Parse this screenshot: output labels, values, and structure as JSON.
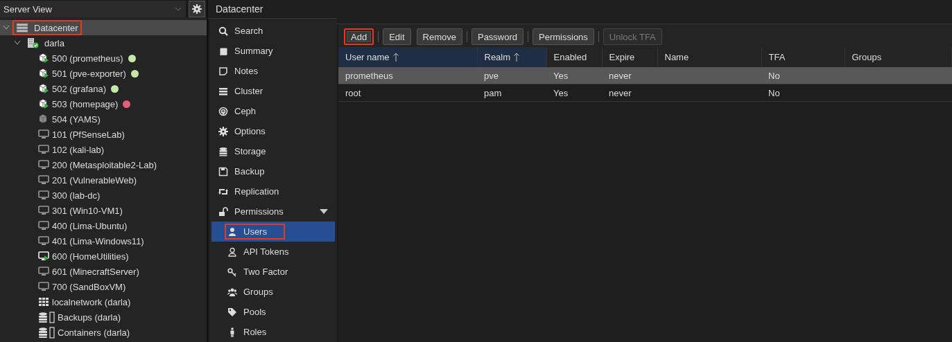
{
  "view_selector": {
    "value": "Server View"
  },
  "tree": [
    {
      "label": "Datacenter",
      "kind": "datacenter",
      "selected": true,
      "highlighted": true,
      "expanded": true,
      "children": [
        {
          "label": "darla",
          "kind": "node",
          "selected": false,
          "highlighted": false,
          "expanded": true,
          "children": [
            {
              "label": "500 (prometheus)",
              "kind": "container",
              "running": true,
              "color": "#c5e8a8",
              "selected": false,
              "highlighted": false
            },
            {
              "label": "501 (pve-exporter)",
              "kind": "container",
              "running": true,
              "color": "#c5e8a8",
              "selected": false,
              "highlighted": false
            },
            {
              "label": "502 (grafana)",
              "kind": "container",
              "running": true,
              "color": "#c5e8a8",
              "selected": false,
              "highlighted": false
            },
            {
              "label": "503 (homepage)",
              "kind": "container",
              "running": true,
              "color": "#e85b7e",
              "selected": false,
              "highlighted": false
            },
            {
              "label": "504 (YAMS)",
              "kind": "container",
              "running": false,
              "selected": false,
              "highlighted": false
            },
            {
              "label": "101 (PfSenseLab)",
              "kind": "vm",
              "running": false,
              "selected": false,
              "highlighted": false
            },
            {
              "label": "102 (kali-lab)",
              "kind": "vm",
              "running": false,
              "selected": false,
              "highlighted": false
            },
            {
              "label": "200 (Metasploitable2-Lab)",
              "kind": "vm",
              "running": false,
              "selected": false,
              "highlighted": false
            },
            {
              "label": "201 (VulnerableWeb)",
              "kind": "vm",
              "running": false,
              "selected": false,
              "highlighted": false
            },
            {
              "label": "300 (lab-dc)",
              "kind": "vm",
              "running": false,
              "selected": false,
              "highlighted": false
            },
            {
              "label": "301 (Win10-VM1)",
              "kind": "vm",
              "running": false,
              "selected": false,
              "highlighted": false
            },
            {
              "label": "400 (Lima-Ubuntu)",
              "kind": "vm",
              "running": false,
              "selected": false,
              "highlighted": false
            },
            {
              "label": "401 (Lima-Windows11)",
              "kind": "vm",
              "running": false,
              "selected": false,
              "highlighted": false
            },
            {
              "label": "600 (HomeUtilities)",
              "kind": "vm",
              "running": true,
              "selected": false,
              "highlighted": false
            },
            {
              "label": "601 (MinecraftServer)",
              "kind": "vm",
              "running": false,
              "selected": false,
              "highlighted": false
            },
            {
              "label": "700 (SandBoxVM)",
              "kind": "vm",
              "running": false,
              "selected": false,
              "highlighted": false
            },
            {
              "label": "localnetwork (darla)",
              "kind": "network",
              "selected": false,
              "highlighted": false
            },
            {
              "label": "Backups (darla)",
              "kind": "storage",
              "selected": false,
              "highlighted": false
            },
            {
              "label": "Containers (darla)",
              "kind": "storage",
              "selected": false,
              "highlighted": false
            }
          ]
        }
      ]
    }
  ],
  "panel_title": "Datacenter",
  "nav": [
    {
      "label": "Search",
      "selected": false,
      "highlighted": false
    },
    {
      "label": "Summary",
      "selected": false,
      "highlighted": false
    },
    {
      "label": "Notes",
      "selected": false,
      "highlighted": false
    },
    {
      "label": "Cluster",
      "selected": false,
      "highlighted": false
    },
    {
      "label": "Ceph",
      "selected": false,
      "highlighted": false
    },
    {
      "label": "Options",
      "selected": false,
      "highlighted": false
    },
    {
      "label": "Storage",
      "selected": false,
      "highlighted": false
    },
    {
      "label": "Backup",
      "selected": false,
      "highlighted": false
    },
    {
      "label": "Replication",
      "selected": false,
      "highlighted": false
    },
    {
      "label": "Permissions",
      "selected": false,
      "highlighted": false,
      "expanded": true,
      "children": [
        {
          "label": "Users",
          "selected": true,
          "highlighted": true
        },
        {
          "label": "API Tokens",
          "selected": false,
          "highlighted": false
        },
        {
          "label": "Two Factor",
          "selected": false,
          "highlighted": false
        },
        {
          "label": "Groups",
          "selected": false,
          "highlighted": false
        },
        {
          "label": "Pools",
          "selected": false,
          "highlighted": false
        },
        {
          "label": "Roles",
          "selected": false,
          "highlighted": false
        }
      ]
    }
  ],
  "toolbar": [
    {
      "label": "Add",
      "disabled": false,
      "highlighted": true
    },
    {
      "label": "Edit",
      "disabled": false,
      "highlighted": false
    },
    {
      "label": "Remove",
      "disabled": false,
      "highlighted": false
    },
    {
      "label": "Password",
      "disabled": false,
      "highlighted": false
    },
    {
      "label": "Permissions",
      "disabled": false,
      "highlighted": false
    },
    {
      "label": "Unlock TFA",
      "disabled": true,
      "highlighted": false
    }
  ],
  "table": {
    "columns": [
      {
        "label": "User name",
        "sorted": true
      },
      {
        "label": "Realm",
        "sorted": true
      },
      {
        "label": "Enabled",
        "sorted": false
      },
      {
        "label": "Expire",
        "sorted": false
      },
      {
        "label": "Name",
        "sorted": false
      },
      {
        "label": "TFA",
        "sorted": false
      },
      {
        "label": "Groups",
        "sorted": false
      }
    ],
    "rows": [
      {
        "selected": true,
        "cells": [
          "prometheus",
          "pve",
          "Yes",
          "never",
          "",
          "No",
          ""
        ]
      },
      {
        "selected": false,
        "cells": [
          "root",
          "pam",
          "Yes",
          "never",
          "",
          "No",
          ""
        ]
      }
    ]
  }
}
